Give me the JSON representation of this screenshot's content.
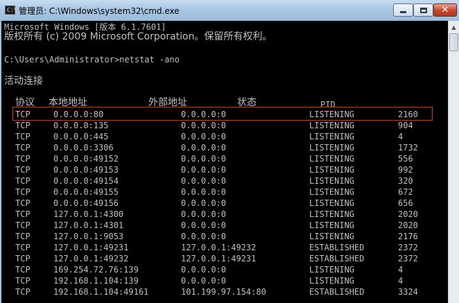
{
  "window": {
    "title": "管理员: C:\\Windows\\system32\\cmd.exe",
    "app_icon_text": "C:\\",
    "controls": {
      "minimize_icon": "minimize-icon",
      "maximize_icon": "maximize-icon",
      "close_icon": "close-icon"
    }
  },
  "console": {
    "banner_line1": "Microsoft Windows [版本 6.1.7601]",
    "banner_line2": "版权所有 (c) 2009 Microsoft Corporation。保留所有权利。",
    "prompt": "C:\\Users\\Administrator>netstat -ano",
    "section_title": "活动连接",
    "headers": {
      "proto": "协议",
      "local": "本地地址",
      "foreign": "外部地址",
      "state": "状态",
      "pid": "PID"
    },
    "rows": [
      {
        "proto": "TCP",
        "local": "0.0.0.0:80",
        "foreign": "0.0.0.0:0",
        "state": "LISTENING",
        "pid": "2160"
      },
      {
        "proto": "TCP",
        "local": "0.0.0.0:135",
        "foreign": "0.0.0.0:0",
        "state": "LISTENING",
        "pid": "904"
      },
      {
        "proto": "TCP",
        "local": "0.0.0.0:445",
        "foreign": "0.0.0.0:0",
        "state": "LISTENING",
        "pid": "4"
      },
      {
        "proto": "TCP",
        "local": "0.0.0.0:3306",
        "foreign": "0.0.0.0:0",
        "state": "LISTENING",
        "pid": "1732"
      },
      {
        "proto": "TCP",
        "local": "0.0.0.0:49152",
        "foreign": "0.0.0.0:0",
        "state": "LISTENING",
        "pid": "556"
      },
      {
        "proto": "TCP",
        "local": "0.0.0.0:49153",
        "foreign": "0.0.0.0:0",
        "state": "LISTENING",
        "pid": "992"
      },
      {
        "proto": "TCP",
        "local": "0.0.0.0:49154",
        "foreign": "0.0.0.0:0",
        "state": "LISTENING",
        "pid": "320"
      },
      {
        "proto": "TCP",
        "local": "0.0.0.0:49155",
        "foreign": "0.0.0.0:0",
        "state": "LISTENING",
        "pid": "672"
      },
      {
        "proto": "TCP",
        "local": "0.0.0.0:49156",
        "foreign": "0.0.0.0:0",
        "state": "LISTENING",
        "pid": "656"
      },
      {
        "proto": "TCP",
        "local": "127.0.0.1:4300",
        "foreign": "0.0.0.0:0",
        "state": "LISTENING",
        "pid": "2020"
      },
      {
        "proto": "TCP",
        "local": "127.0.0.1:4301",
        "foreign": "0.0.0.0:0",
        "state": "LISTENING",
        "pid": "2020"
      },
      {
        "proto": "TCP",
        "local": "127.0.0.1:9053",
        "foreign": "0.0.0.0:0",
        "state": "LISTENING",
        "pid": "2176"
      },
      {
        "proto": "TCP",
        "local": "127.0.0.1:49231",
        "foreign": "127.0.0.1:49232",
        "state": "ESTABLISHED",
        "pid": "2372"
      },
      {
        "proto": "TCP",
        "local": "127.0.0.1:49232",
        "foreign": "127.0.0.1:49231",
        "state": "ESTABLISHED",
        "pid": "2372"
      },
      {
        "proto": "TCP",
        "local": "169.254.72.76:139",
        "foreign": "0.0.0.0:0",
        "state": "LISTENING",
        "pid": "4"
      },
      {
        "proto": "TCP",
        "local": "192.168.1.104:139",
        "foreign": "0.0.0.0:0",
        "state": "LISTENING",
        "pid": "4"
      },
      {
        "proto": "TCP",
        "local": "192.168.1.104:49161",
        "foreign": "101.199.97.154:80",
        "state": "ESTABLISHED",
        "pid": "3324"
      }
    ],
    "highlighted_row": 0,
    "highlight_color": "#d23c2c",
    "text_color": "#c0c0c0",
    "background_color": "#000000"
  },
  "scrollbar": {
    "up_icon": "scroll-up-arrow-icon"
  }
}
